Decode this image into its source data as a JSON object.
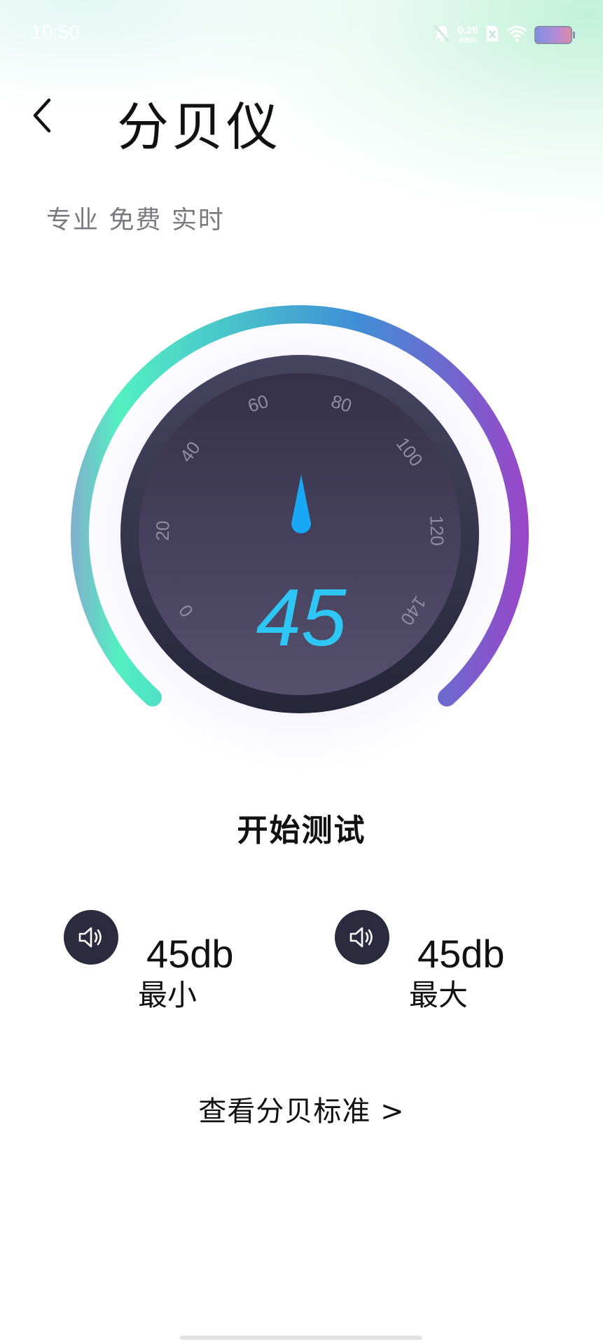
{
  "status_bar": {
    "time": "10:50",
    "net_speed_value": "0.20",
    "net_speed_unit": "KB/s",
    "icons": [
      "mute-icon",
      "sim-icon",
      "wifi-icon",
      "battery-icon"
    ]
  },
  "header": {
    "back_icon": "chevron-left-icon",
    "title": "分贝仪",
    "subtitle": "专业 免费 实时"
  },
  "gauge": {
    "value": "45",
    "min_scale": 0,
    "max_scale": 140,
    "needle_value": 70,
    "ticks": [
      "0",
      "20",
      "40",
      "60",
      "80",
      "100",
      "120",
      "140"
    ],
    "colors": {
      "arc_start": "#7fb2cc",
      "arc_green": "#52f0c2",
      "arc_blue": "#3f8fd6",
      "arc_end": "#9a45c8",
      "dial_top": "#36314a",
      "dial_bottom": "#54506e",
      "needle": "#19a8f5",
      "value": "#2ec7f5"
    }
  },
  "actions": {
    "start_label": "开始测试",
    "standard_link": "查看分贝标准 >"
  },
  "stats": {
    "min": {
      "value": "45db",
      "label": "最小",
      "icon": "speaker-icon"
    },
    "max": {
      "value": "45db",
      "label": "最大",
      "icon": "speaker-icon"
    }
  }
}
